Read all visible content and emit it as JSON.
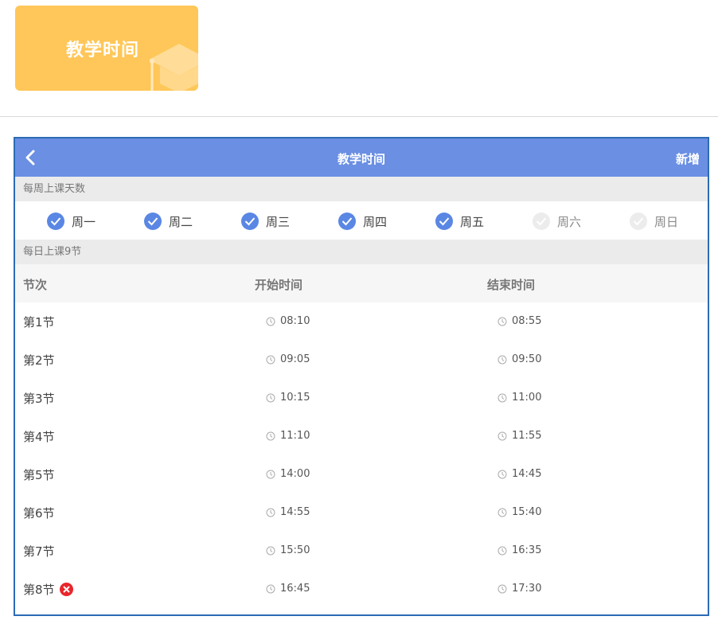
{
  "tile": {
    "title": "教学时间",
    "icon": "graduation-cap-icon"
  },
  "navbar": {
    "back_icon": "chevron-left-icon",
    "title": "教学时间",
    "add_label": "新增"
  },
  "weekdays_section": {
    "header": "每周上课天数",
    "days": [
      {
        "label": "周一",
        "checked": true
      },
      {
        "label": "周二",
        "checked": true
      },
      {
        "label": "周三",
        "checked": true
      },
      {
        "label": "周四",
        "checked": true
      },
      {
        "label": "周五",
        "checked": true
      },
      {
        "label": "周六",
        "checked": false
      },
      {
        "label": "周日",
        "checked": false
      }
    ]
  },
  "periods_section": {
    "header": "每日上课9节",
    "columns": {
      "period": "节次",
      "start": "开始时间",
      "end": "结束时间"
    },
    "rows": [
      {
        "name": "第1节",
        "start": "08:10",
        "end": "08:55"
      },
      {
        "name": "第2节",
        "start": "09:05",
        "end": "09:50"
      },
      {
        "name": "第3节",
        "start": "10:15",
        "end": "11:00"
      },
      {
        "name": "第4节",
        "start": "11:10",
        "end": "11:55"
      },
      {
        "name": "第5节",
        "start": "14:00",
        "end": "14:45"
      },
      {
        "name": "第6节",
        "start": "14:55",
        "end": "15:40"
      },
      {
        "name": "第7节",
        "start": "15:50",
        "end": "16:35"
      },
      {
        "name": "第8节",
        "start": "16:45",
        "end": "17:30",
        "deletable": true
      }
    ]
  },
  "colors": {
    "navbar_bg": "#6a8fe3",
    "checked": "#5a87e4",
    "tile_bg": "#ffc759",
    "delete": "#e8262b",
    "frame_border": "#2c6bb5"
  }
}
